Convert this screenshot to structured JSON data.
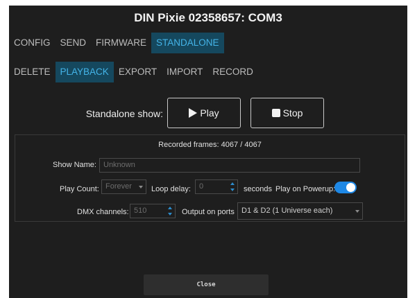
{
  "window": {
    "title": "DIN Pixie 02358657: COM3"
  },
  "main_tabs": [
    "CONFIG",
    "SEND",
    "FIRMWARE",
    "STANDALONE"
  ],
  "sub_tabs": [
    "DELETE",
    "PLAYBACK",
    "EXPORT",
    "IMPORT",
    "RECORD"
  ],
  "controls": {
    "show_label": "Standalone show:",
    "play_label": "Play",
    "stop_label": "Stop"
  },
  "panel": {
    "recorded_frames_label": "Recorded frames:",
    "recorded_frames": "4067",
    "frames_separator": "/",
    "total_frames": "4067",
    "show_name_label": "Show Name:",
    "show_name_placeholder": "Unknown",
    "play_count_label": "Play Count:",
    "play_count_value": "Forever",
    "loop_delay_label": "Loop delay:",
    "loop_delay_value": "0",
    "seconds_label": "seconds",
    "play_on_powerup_label": "Play on Powerup:",
    "play_on_powerup": true,
    "dmx_channels_label": "DMX channels:",
    "dmx_channels_value": "510",
    "output_ports_label": "Output on ports",
    "output_ports_value": "D1 & D2 (1 Universe each)"
  },
  "footer": {
    "close_label": "Close"
  },
  "colors": {
    "background": "#1e1e1e",
    "active_tab_bg": "#15485e",
    "active_tab_text": "#44b4e8",
    "toggle_on": "#1e88e5"
  }
}
